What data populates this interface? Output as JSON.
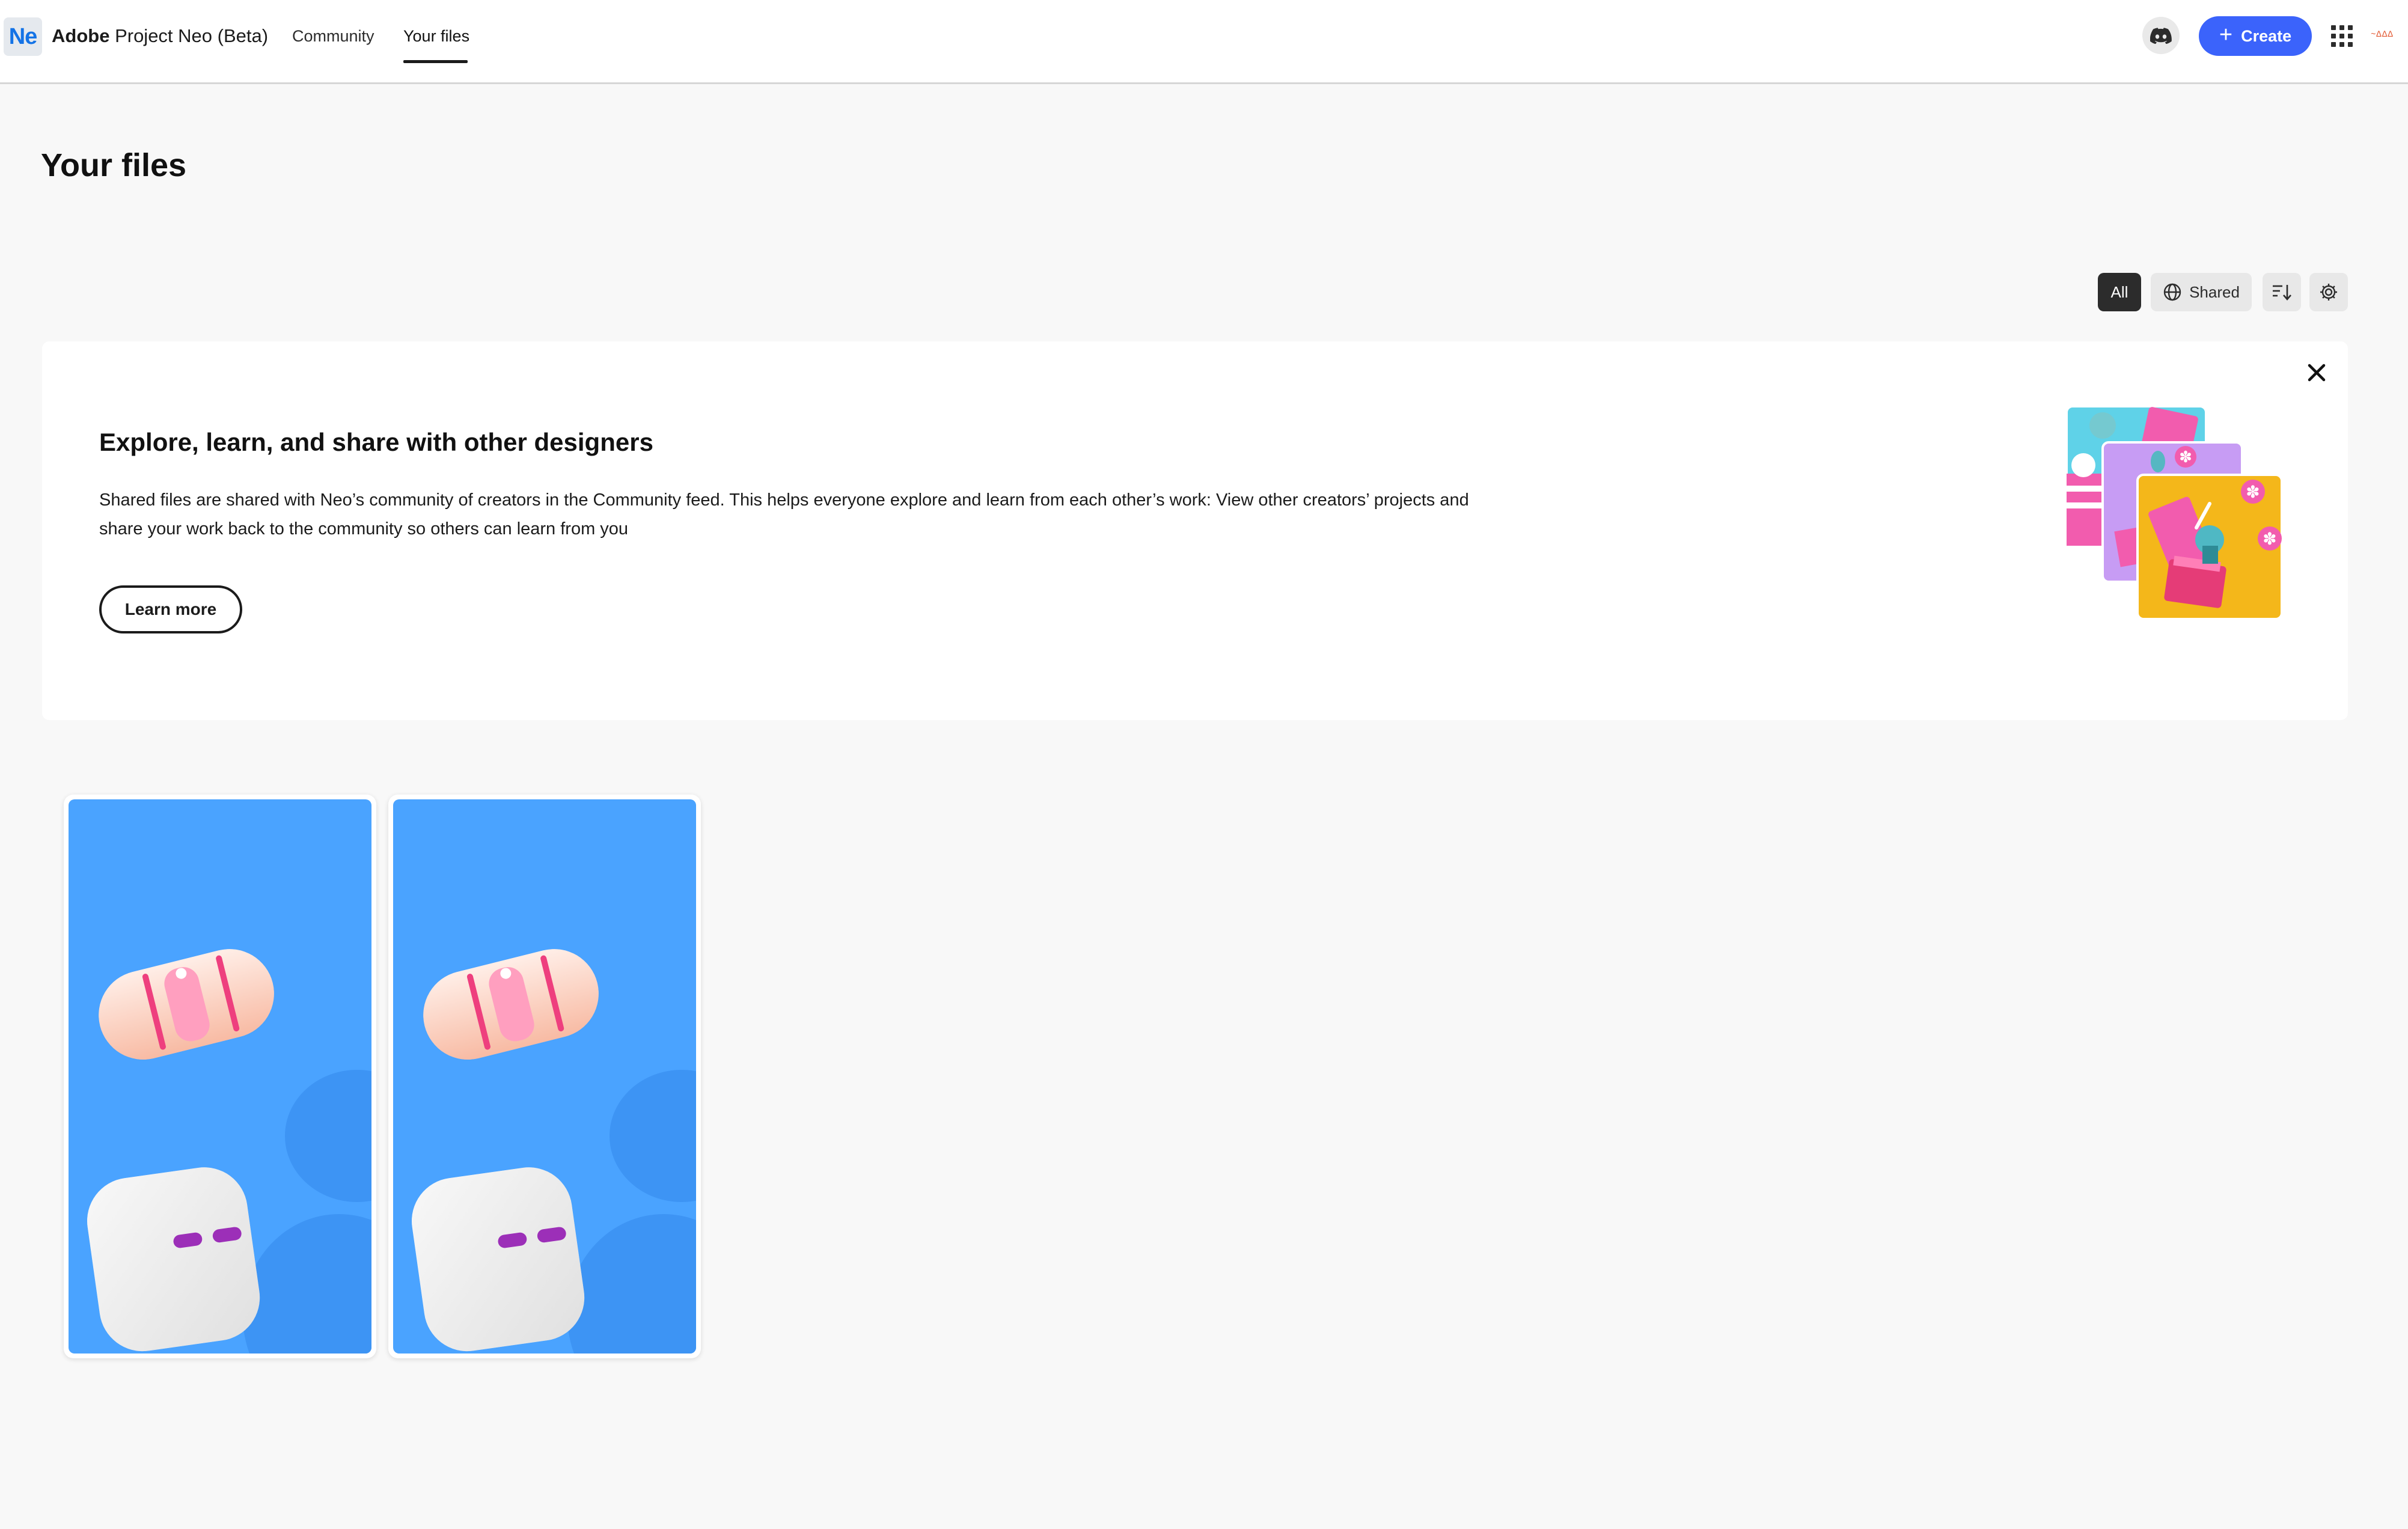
{
  "header": {
    "logo_text": "Ne",
    "app_brand": "Adobe",
    "app_name": "Project Neo (Beta)",
    "tabs": [
      {
        "label": "Community",
        "active": false
      },
      {
        "label": "Your files",
        "active": true
      }
    ],
    "create_label": "Create",
    "avatar_text": "~∆∆∆"
  },
  "page": {
    "title": "Your files"
  },
  "filters": {
    "all_label": "All",
    "shared_label": "Shared",
    "selected": "All"
  },
  "banner": {
    "title": "Explore, learn, and share with other designers",
    "text": "Shared files are shared with Neo’s community of creators in the Community feed. This helps everyone explore and learn from each other’s work: View other creators’ projects and share your work back to the community so others can learn from you",
    "button_label": "Learn more"
  },
  "files": [
    {
      "thumbnail": "nail-and-cube-3d-scene"
    },
    {
      "thumbnail": "nail-and-cube-3d-scene"
    }
  ],
  "colors": {
    "accent": "#3b63fb",
    "logo": "#1473e6",
    "thumb_background": "#4aa3ff",
    "page_background": "#f8f8f8"
  }
}
